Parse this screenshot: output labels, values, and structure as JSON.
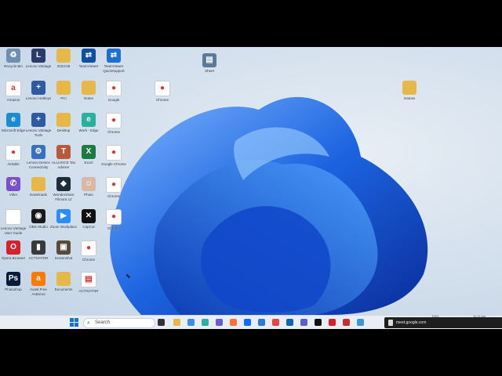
{
  "desktop": {
    "icons": [
      {
        "label": "Recycle Bin",
        "glyph": "♻",
        "color": "#6e8fb0"
      },
      {
        "label": "Lenovo Vantage",
        "glyph": "L",
        "color": "#2a3a6a"
      },
      {
        "label": "2023-05",
        "glyph": "",
        "color": "#e6b84a"
      },
      {
        "label": "TeamViewer",
        "glyph": "⇄",
        "color": "#0d4fa0"
      },
      {
        "label": "TeamViewer QuickSupport",
        "glyph": "⇄",
        "color": "#1e6fd0"
      },
      {
        "label": "Amazon",
        "glyph": "a",
        "color": "#ffffff"
      },
      {
        "label": "Lenovo Hotkeys",
        "glyph": "+",
        "color": "#2d5aa0"
      },
      {
        "label": "PCI",
        "glyph": "",
        "color": "#e6b84a"
      },
      {
        "label": "Notes",
        "glyph": "",
        "color": "#e6b84a"
      },
      {
        "label": "Google",
        "glyph": "●",
        "color": "#ffffff"
      },
      {
        "label": "Microsoft Edge",
        "glyph": "e",
        "color": "#1a8ccf"
      },
      {
        "label": "Lenovo Vantage Tools",
        "glyph": "+",
        "color": "#2d5aa0"
      },
      {
        "label": "Desktop",
        "glyph": "",
        "color": "#e6b84a"
      },
      {
        "label": "Work - Edge",
        "glyph": "e",
        "color": "#2bb0a0"
      },
      {
        "label": "Chrome",
        "glyph": "●",
        "color": "#ffffff"
      },
      {
        "label": "Airtable",
        "glyph": "●",
        "color": "#ffffff"
      },
      {
        "label": "Lenovo Device Connectivity",
        "glyph": "⚙",
        "color": "#3a6ec0"
      },
      {
        "label": "ALLIANCE Tax Adviser",
        "glyph": "T",
        "color": "#b85a3a"
      },
      {
        "label": "Excel",
        "glyph": "X",
        "color": "#1d7a43"
      },
      {
        "label": "Google Chrome",
        "glyph": "●",
        "color": "#ffffff"
      },
      {
        "label": "Viber",
        "glyph": "✆",
        "color": "#7a4fc9"
      },
      {
        "label": "Downloads",
        "glyph": "",
        "color": "#e6b84a"
      },
      {
        "label": "Wondershare Filmora 12",
        "glyph": "◆",
        "color": "#1d2c3a"
      },
      {
        "label": "Photo",
        "glyph": "☺",
        "color": "#d9b8a8"
      },
      {
        "label": "Chrome",
        "glyph": "●",
        "color": "#ffffff"
      },
      {
        "label": "Lenovo Vantage User Guide",
        "glyph": "",
        "color": "#ffffff"
      },
      {
        "label": "OBS Studio",
        "glyph": "◉",
        "color": "#1a1a1a"
      },
      {
        "label": "Zoom Workplace",
        "glyph": "▶",
        "color": "#2d8cff"
      },
      {
        "label": "CapCut",
        "glyph": "✕",
        "color": "#111111"
      },
      {
        "label": "Chrome",
        "glyph": "●",
        "color": "#ffffff"
      },
      {
        "label": "Opera Browser",
        "glyph": "O",
        "color": "#d6202c"
      },
      {
        "label": "ACTIVATOR",
        "glyph": "▮",
        "color": "#3a3a3a"
      },
      {
        "label": "Screenshot",
        "glyph": "▣",
        "color": "#5a4a3a"
      },
      {
        "label": "Chrome",
        "glyph": "●",
        "color": "#ffffff"
      },
      {
        "label": "Photoshop",
        "glyph": "Ps",
        "color": "#0a1a3a"
      },
      {
        "label": "Avast Free Antivirus",
        "glyph": "a",
        "color": "#ff7a00"
      },
      {
        "label": "Documents",
        "glyph": "",
        "color": "#e6b84a"
      },
      {
        "label": "ACTIVATOR",
        "glyph": "▤",
        "color": "#ffffff"
      },
      {
        "label": "Sheet",
        "glyph": "▤",
        "color": "#5a7a9a"
      },
      {
        "label": "Chrome",
        "glyph": "●",
        "color": "#ffffff"
      },
      {
        "label": "Games",
        "glyph": "",
        "color": "#e6b84a"
      }
    ]
  },
  "taskbar": {
    "search_placeholder": "Search",
    "toast_text": "meet.google.com",
    "lang": "ENG",
    "time": "11:11 am"
  }
}
